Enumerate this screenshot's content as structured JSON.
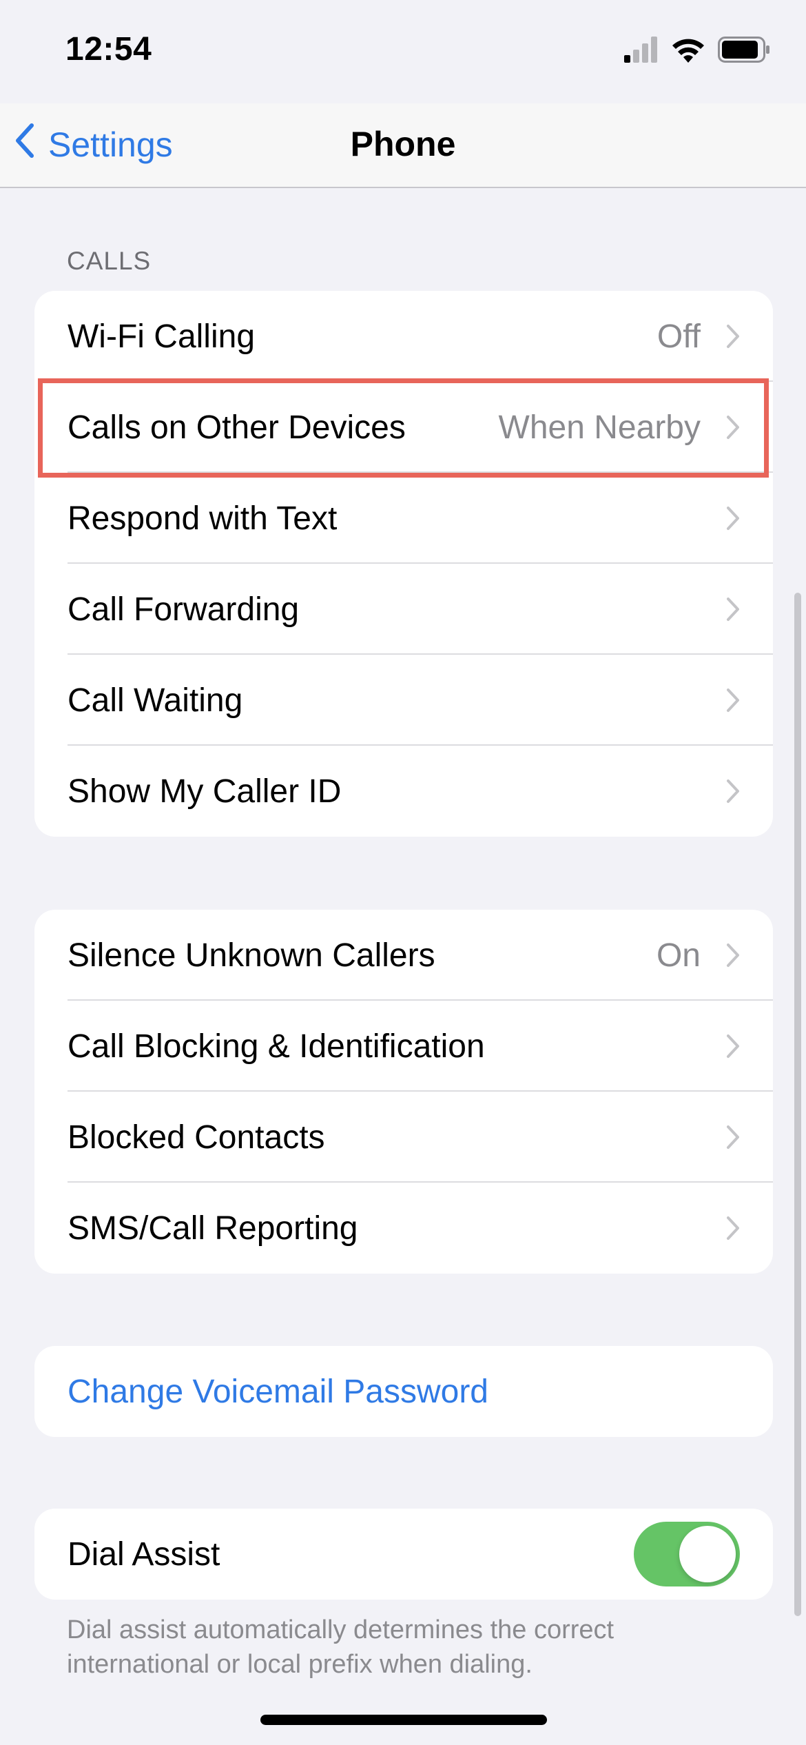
{
  "status_bar": {
    "time": "12:54",
    "battery_level": 0.85
  },
  "nav": {
    "back_label": "Settings",
    "title": "Phone"
  },
  "sections": {
    "calls_header": "CALLS"
  },
  "calls_group": [
    {
      "label": "Wi-Fi Calling",
      "value": "Off"
    },
    {
      "label": "Calls on Other Devices",
      "value": "When Nearby"
    },
    {
      "label": "Respond with Text",
      "value": ""
    },
    {
      "label": "Call Forwarding",
      "value": ""
    },
    {
      "label": "Call Waiting",
      "value": ""
    },
    {
      "label": "Show My Caller ID",
      "value": ""
    }
  ],
  "blocking_group": [
    {
      "label": "Silence Unknown Callers",
      "value": "On"
    },
    {
      "label": "Call Blocking & Identification",
      "value": ""
    },
    {
      "label": "Blocked Contacts",
      "value": ""
    },
    {
      "label": "SMS/Call Reporting",
      "value": ""
    }
  ],
  "voicemail": {
    "label": "Change Voicemail Password"
  },
  "dial_assist": {
    "label": "Dial Assist",
    "enabled": true,
    "footer": "Dial assist automatically determines the correct international or local prefix when dialing."
  },
  "colors": {
    "accent_blue": "#2f7ae5",
    "toggle_green": "#65c466",
    "highlight_red": "#e8655a",
    "background": "#f2f2f7"
  }
}
